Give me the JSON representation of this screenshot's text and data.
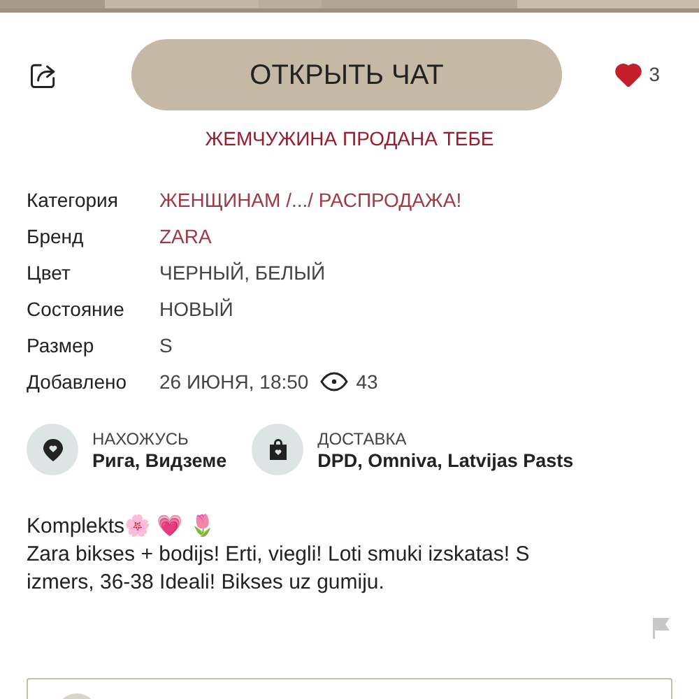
{
  "actions": {
    "chat_button": "ОТКРЫТЬ ЧАТ",
    "likes": {
      "liked": true,
      "count": "3"
    }
  },
  "sold_notice": "ЖЕМЧУЖИНА ПРОДАНА ТЕБЕ",
  "details": [
    {
      "label": "Категория",
      "value": "ЖЕНЩИНАМ /.../ РАСПРОДАЖА!",
      "kind": "link"
    },
    {
      "label": "Бренд",
      "value": "ZARA",
      "kind": "link"
    },
    {
      "label": "Цвет",
      "value": "ЧЕРНЫЙ, БЕЛЫЙ",
      "kind": "plain"
    },
    {
      "label": "Состояние",
      "value": "НОВЫЙ",
      "kind": "plain"
    },
    {
      "label": "Размер",
      "value": "S",
      "kind": "plain"
    },
    {
      "label": "Добавлено",
      "value": "26 ИЮНЯ, 18:50",
      "kind": "date",
      "views": "43"
    }
  ],
  "info": [
    {
      "kind": "location",
      "title": "НАХОЖУСЬ",
      "value": "Рига, Видземе"
    },
    {
      "kind": "delivery",
      "title": "ДОСТАВКА",
      "value": "DPD, Omniva, Latvijas Pasts"
    }
  ],
  "description": [
    "Komplekts🌸 💗 🌷",
    "Zara bikses + bodijs! Erti, viegli! Loti smuki izskatas! S izmers, 36-38 Ideali! Bikses uz gumiju."
  ]
}
